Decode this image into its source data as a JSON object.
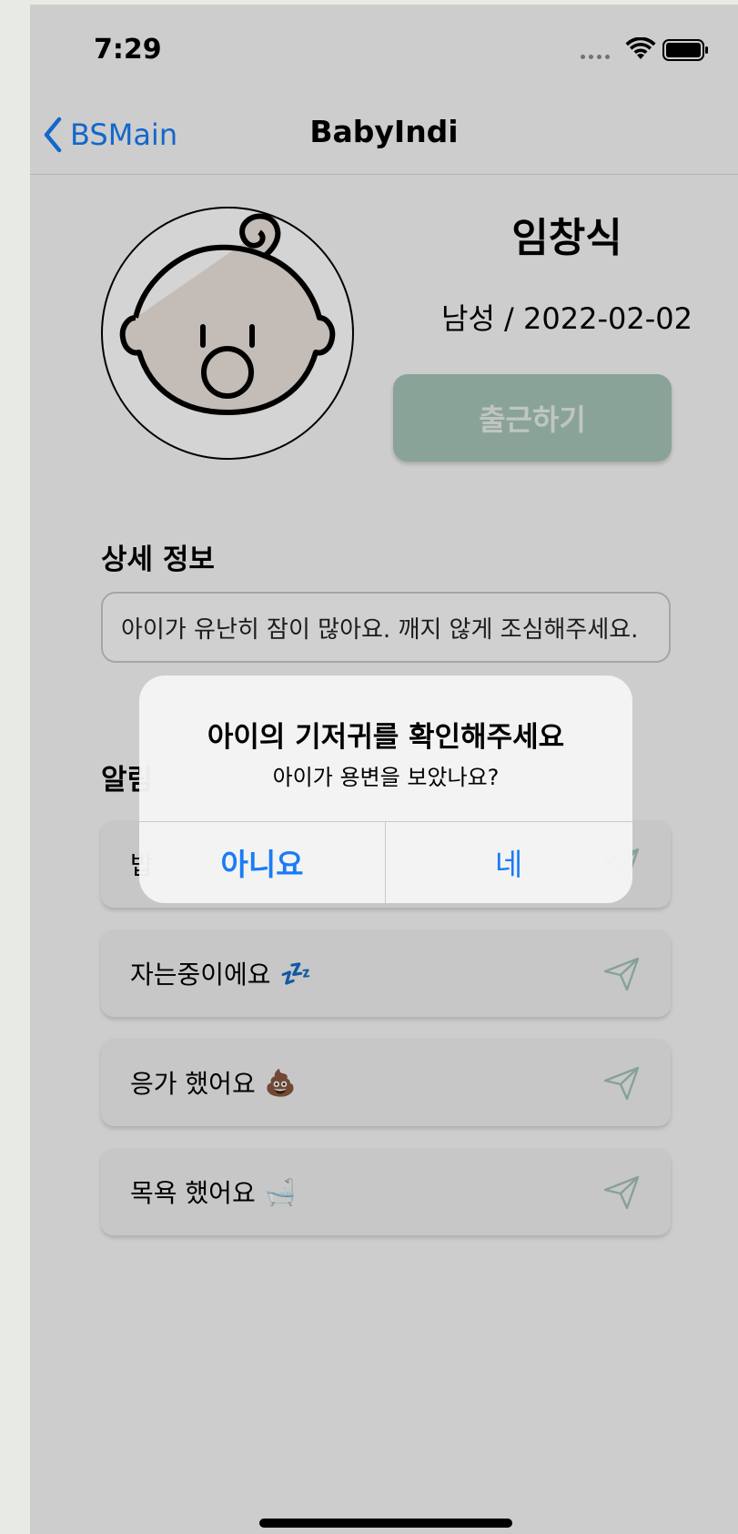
{
  "status_bar": {
    "time": "7:29"
  },
  "nav": {
    "back_label": "BSMain",
    "title": "BabyIndi"
  },
  "profile": {
    "name": "임창식",
    "info": "남성 / 2022-02-02",
    "checkin_label": "출근하기"
  },
  "details": {
    "title": "상세 정보",
    "text": "아이가 유난히 잠이 많아요. 깨지 않게 조심해주세요."
  },
  "alarms": {
    "title_visible": "알림",
    "items": [
      {
        "label": "밥",
        "emoji": ""
      },
      {
        "label": "자는중이에요",
        "emoji": "💤"
      },
      {
        "label": "응가 했어요",
        "emoji": "💩"
      },
      {
        "label": "목욕 했어요",
        "emoji": "🛁"
      }
    ]
  },
  "alert": {
    "title": "아이의 기저귀를 확인해주세요",
    "message": "아이가 용변을 보았나요?",
    "cancel_label": "아니요",
    "confirm_label": "네"
  },
  "colors": {
    "accent": "#1a7cf5",
    "checkin_button": "#a7c4b7",
    "background": "#f7f7f7"
  },
  "icons": {
    "back": "chevron-left-icon",
    "send": "send-icon",
    "wifi": "wifi-icon",
    "battery": "battery-icon",
    "avatar": "baby-face-icon"
  }
}
